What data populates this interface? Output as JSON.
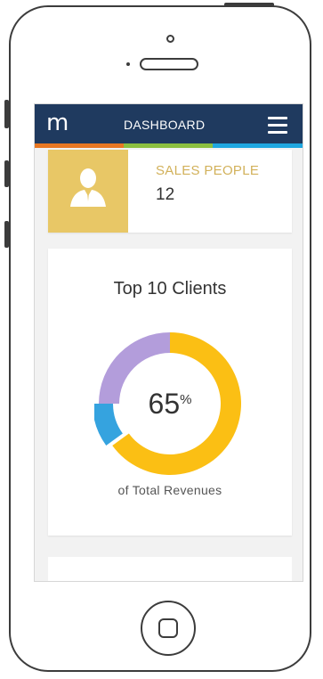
{
  "app": {
    "logo_char": "m",
    "title": "DASHBOARD",
    "menu_icon": "hamburger-menu-icon",
    "bar_color": "#1f3a5f",
    "accent_strip": [
      "#e87722",
      "#8bbf3f",
      "#1fa7e0"
    ]
  },
  "sales_card": {
    "icon": "person-icon",
    "label": "SALES PEOPLE",
    "value": "12",
    "color": "#e8c766"
  },
  "clients_card": {
    "title": "Top 10 Clients",
    "percent_value": "65",
    "percent_symbol": "%",
    "caption": "of Total Revenues",
    "chart_data": {
      "type": "pie",
      "values": [
        65,
        10,
        25
      ],
      "colors": [
        "#fbbf14",
        "#35a3df",
        "#b39ddb"
      ]
    }
  }
}
